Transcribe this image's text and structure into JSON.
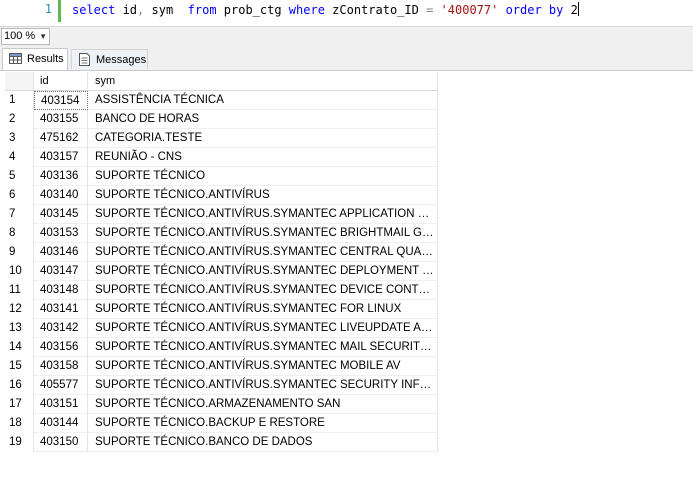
{
  "editor": {
    "line_number": "1",
    "tokens": {
      "t1": "select",
      "t2": " id",
      "t3": ",",
      "t4": " sym  ",
      "t5": "from",
      "t6": " prob_ctg ",
      "t7": "where",
      "t8": " zContrato_ID ",
      "t9": "=",
      "t10": " ",
      "t11": "'400077'",
      "t12": " ",
      "t13": "order by",
      "t14": " 2"
    }
  },
  "zoom": {
    "value": "100 %"
  },
  "tabs": {
    "results": "Results",
    "messages": "Messages"
  },
  "grid": {
    "columns": {
      "id": "id",
      "sym": "sym"
    },
    "rows": [
      {
        "n": "1",
        "id": "403154",
        "sym": "ASSISTÊNCIA TÉCNICA"
      },
      {
        "n": "2",
        "id": "403155",
        "sym": "BANCO DE HORAS"
      },
      {
        "n": "3",
        "id": "475162",
        "sym": "CATEGORIA.TESTE"
      },
      {
        "n": "4",
        "id": "403157",
        "sym": "REUNIÃO - CNS"
      },
      {
        "n": "5",
        "id": "403136",
        "sym": "SUPORTE TÉCNICO"
      },
      {
        "n": "6",
        "id": "403140",
        "sym": "SUPORTE TÉCNICO.ANTIVÍRUS"
      },
      {
        "n": "7",
        "id": "403145",
        "sym": "SUPORTE TÉCNICO.ANTIVÍRUS.SYMANTEC APPLICATION CON..."
      },
      {
        "n": "8",
        "id": "403153",
        "sym": "SUPORTE TÉCNICO.ANTIVÍRUS.SYMANTEC BRIGHTMAIL GATE..."
      },
      {
        "n": "9",
        "id": "403146",
        "sym": "SUPORTE TÉCNICO.ANTIVÍRUS.SYMANTEC CENTRAL QUARA..."
      },
      {
        "n": "10",
        "id": "403147",
        "sym": "SUPORTE TÉCNICO.ANTIVÍRUS.SYMANTEC DEPLOYMENT WIZ..."
      },
      {
        "n": "11",
        "id": "403148",
        "sym": "SUPORTE TÉCNICO.ANTIVÍRUS.SYMANTEC DEVICE CONTROL"
      },
      {
        "n": "12",
        "id": "403141",
        "sym": "SUPORTE TÉCNICO.ANTIVÍRUS.SYMANTEC FOR LINUX"
      },
      {
        "n": "13",
        "id": "403142",
        "sym": "SUPORTE TÉCNICO.ANTIVÍRUS.SYMANTEC LIVEUPDATE ADMI..."
      },
      {
        "n": "14",
        "id": "403156",
        "sym": "SUPORTE TÉCNICO.ANTIVÍRUS.SYMANTEC MAIL SECURITY F..."
      },
      {
        "n": "15",
        "id": "403158",
        "sym": "SUPORTE TÉCNICO.ANTIVÍRUS.SYMANTEC MOBILE AV"
      },
      {
        "n": "16",
        "id": "405577",
        "sym": "SUPORTE TÉCNICO.ANTIVÍRUS.SYMANTEC SECURITY INFOR..."
      },
      {
        "n": "17",
        "id": "403151",
        "sym": "SUPORTE TÉCNICO.ARMAZENAMENTO SAN"
      },
      {
        "n": "18",
        "id": "403144",
        "sym": "SUPORTE TÉCNICO.BACKUP E RESTORE"
      },
      {
        "n": "19",
        "id": "403150",
        "sym": "SUPORTE TÉCNICO.BANCO DE DADOS"
      }
    ]
  }
}
